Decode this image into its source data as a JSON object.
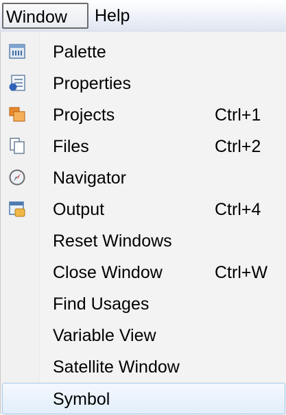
{
  "menubar": {
    "window_label": "Window",
    "help_label": "Help"
  },
  "menu": {
    "items": [
      {
        "label": "Palette",
        "shortcut": "",
        "icon": "palette-icon"
      },
      {
        "label": "Properties",
        "shortcut": "",
        "icon": "properties-icon"
      },
      {
        "label": "Projects",
        "shortcut": "Ctrl+1",
        "icon": "projects-icon"
      },
      {
        "label": "Files",
        "shortcut": "Ctrl+2",
        "icon": "files-icon"
      },
      {
        "label": "Navigator",
        "shortcut": "",
        "icon": "navigator-icon"
      },
      {
        "label": "Output",
        "shortcut": "Ctrl+4",
        "icon": "output-icon"
      },
      {
        "label": "Reset Windows",
        "shortcut": "",
        "icon": ""
      },
      {
        "label": "Close Window",
        "shortcut": "Ctrl+W",
        "icon": ""
      },
      {
        "label": "Find Usages",
        "shortcut": "",
        "icon": ""
      },
      {
        "label": "Variable View",
        "shortcut": "",
        "icon": ""
      },
      {
        "label": "Satellite Window",
        "shortcut": "",
        "icon": ""
      },
      {
        "label": "Symbol",
        "shortcut": "",
        "icon": ""
      }
    ],
    "highlighted_item": "Symbol"
  }
}
